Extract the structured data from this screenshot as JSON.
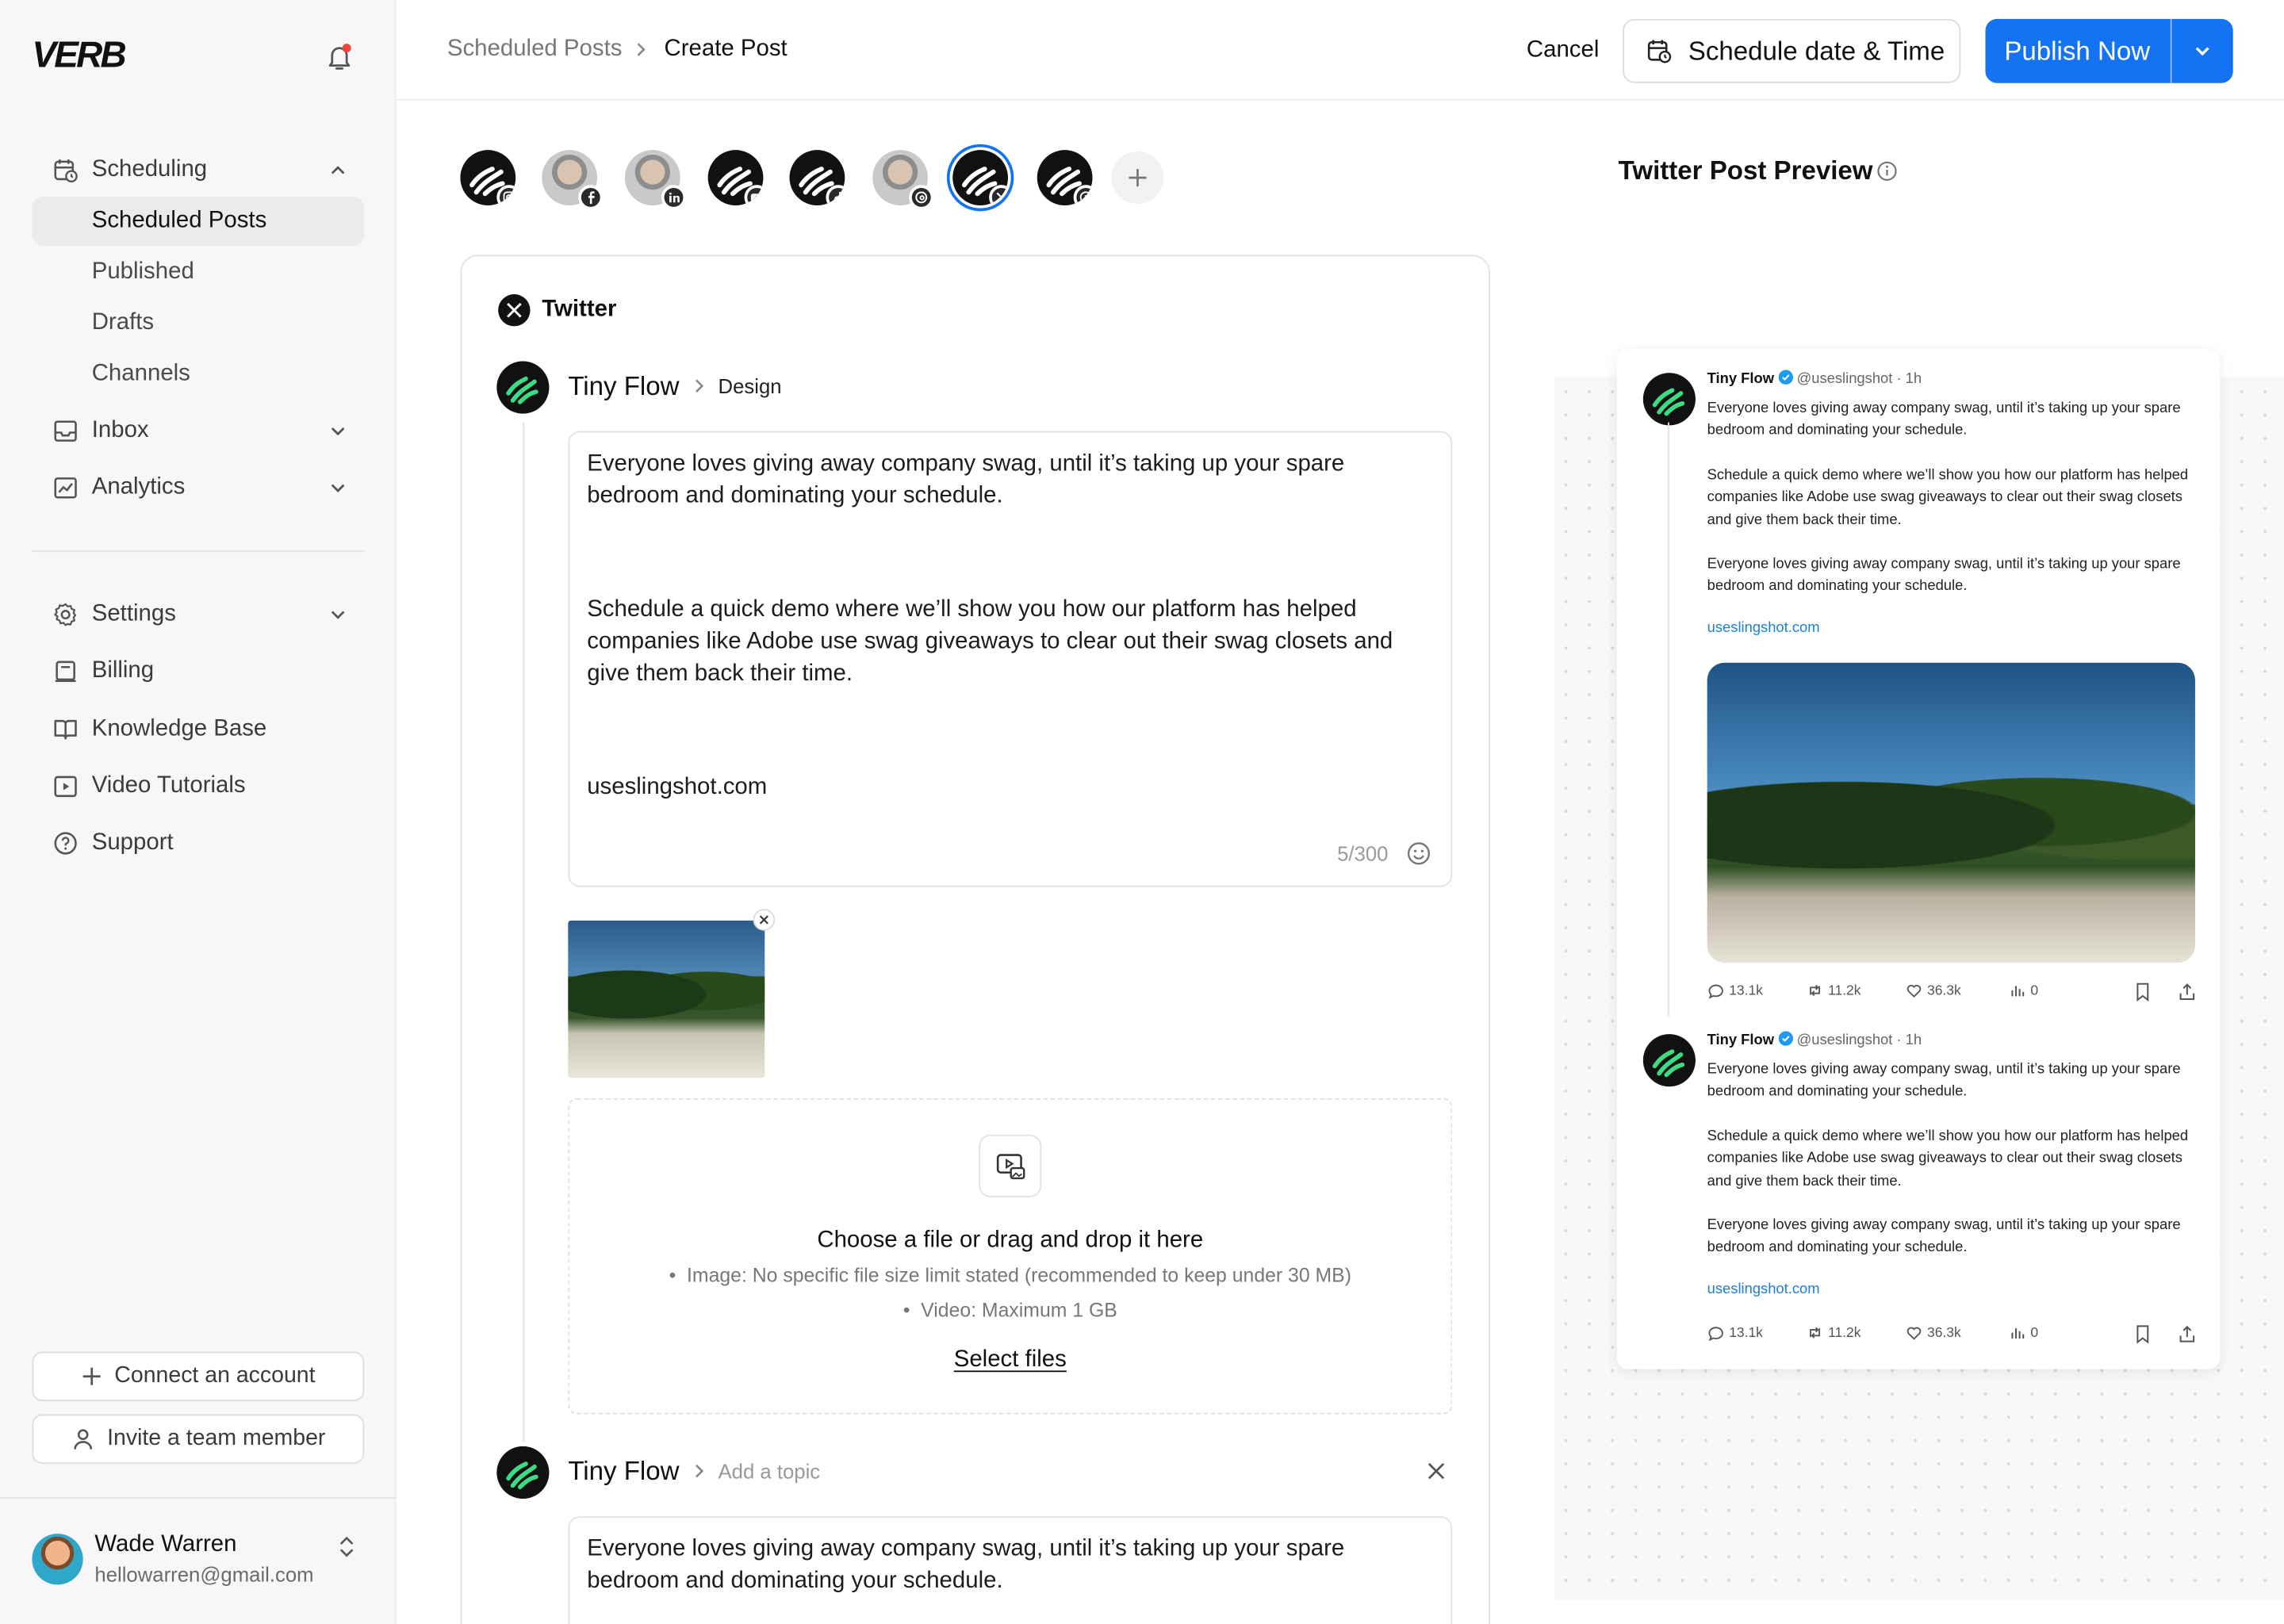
{
  "sidebar": {
    "logo": "VERB",
    "nav": {
      "scheduling": "Scheduling",
      "scheduled_posts": "Scheduled Posts",
      "published": "Published",
      "drafts": "Drafts",
      "channels": "Channels",
      "inbox": "Inbox",
      "analytics": "Analytics",
      "settings": "Settings",
      "billing": "Billing",
      "knowledge_base": "Knowledge Base",
      "video_tutorials": "Video Tutorials",
      "support": "Support"
    },
    "connect_account": "Connect an account",
    "invite_member": "Invite a team member",
    "user": {
      "name": "Wade Warren",
      "email": "hellowarren@gmail.com"
    }
  },
  "header": {
    "breadcrumb_parent": "Scheduled Posts",
    "breadcrumb_current": "Create Post",
    "cancel": "Cancel",
    "schedule": "Schedule date & Time",
    "publish": "Publish Now"
  },
  "accounts": [
    "instagram",
    "facebook",
    "linkedin",
    "youtube",
    "tiktok",
    "threads",
    "x",
    "pinterest"
  ],
  "selected_account": "x",
  "composer": {
    "platform": "Twitter",
    "author": "Tiny Flow",
    "topic": "Design",
    "topic_placeholder": "Add a topic",
    "post_paragraph_1": "Everyone loves giving away company swag, until it’s taking up your spare bedroom and dominating your schedule.",
    "post_paragraph_2": "Schedule a quick demo where we’ll show you how our platform has helped companies like Adobe use swag giveaways to clear out their swag closets and give them back their time.",
    "post_link": "useslingshot.com",
    "char_count": "5/300",
    "upload_title": "Choose a file or drag and drop it here",
    "upload_image_rule": "Image: No specific file size limit stated (recommended to keep under 30 MB)",
    "upload_video_rule": "Video: Maximum 1 GB",
    "select_files": "Select files"
  },
  "preview": {
    "title": "Twitter Post Preview",
    "tweets": [
      {
        "name": "Tiny Flow",
        "meta": "@useslingshot · 1h",
        "p1": "Everyone loves giving away company swag, until it’s taking up your spare bedroom and dominating your schedule.",
        "p2": "Schedule a quick demo where we’ll show you how our platform has helped companies like Adobe use swag giveaways to clear out their swag closets and give them back their time.",
        "p3": "Everyone loves giving away company swag, until it’s taking up your spare bedroom and dominating your schedule.",
        "link": "useslingshot.com",
        "replies": "13.1k",
        "retweets": "11.2k",
        "likes": "36.3k",
        "views": "0"
      },
      {
        "name": "Tiny Flow",
        "meta": "@useslingshot · 1h",
        "p1": "Everyone loves giving away company swag, until it’s taking up your spare bedroom and dominating your schedule.",
        "p2": "Schedule a quick demo where we’ll show you how our platform has helped companies like Adobe use swag giveaways to clear out their swag closets and give them back their time.",
        "p3": "Everyone loves giving away company swag, until it’s taking up your spare bedroom and dominating your schedule.",
        "link": "useslingshot.com",
        "replies": "13.1k",
        "retweets": "11.2k",
        "likes": "36.3k",
        "views": "0"
      }
    ]
  },
  "colors": {
    "primary": "#1473f2",
    "link": "#1d7fd4",
    "verified": "#1d9bf0"
  }
}
